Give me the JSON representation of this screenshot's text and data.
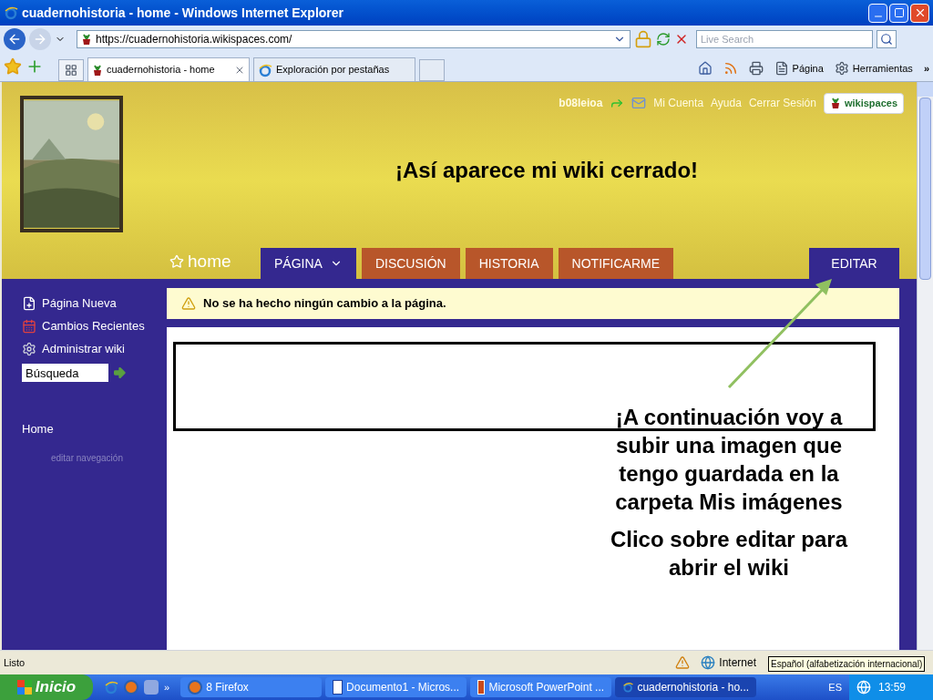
{
  "window": {
    "title": "cuadernohistoria - home - Windows Internet Explorer"
  },
  "address_bar": {
    "url": "https://cuadernohistoria.wikispaces.com/"
  },
  "search": {
    "placeholder": "Live Search"
  },
  "browser_tabs": [
    {
      "label": "cuadernohistoria - home",
      "selected": true
    },
    {
      "label": "Exploración por pestañas",
      "selected": false
    }
  ],
  "command_bar": {
    "page": "Página",
    "tools": "Herramientas",
    "more": "»"
  },
  "user_bar": {
    "username": "b08leioa",
    "links": [
      "Mi Cuenta",
      "Ayuda",
      "Cerrar Sesión"
    ],
    "logo": "wikispaces"
  },
  "header": {
    "title": "¡Así aparece mi wiki cerrado!"
  },
  "page_name": "home",
  "page_tabs": [
    {
      "label": "PÁGINA",
      "selected": true,
      "dropdown": true
    },
    {
      "label": "DISCUSIÓN",
      "selected": false,
      "dropdown": false
    },
    {
      "label": "HISTORIA",
      "selected": false,
      "dropdown": false
    },
    {
      "label": "NOTIFICARME",
      "selected": false,
      "dropdown": false
    }
  ],
  "edit_tab": "EDITAR",
  "sidebar": {
    "items": [
      {
        "label": "Página Nueva",
        "kind": "new"
      },
      {
        "label": "Cambios Recientes",
        "kind": "calendar"
      },
      {
        "label": "Administrar wiki",
        "kind": "gear"
      }
    ],
    "search_value": "Búsqueda",
    "nav": [
      "Home"
    ],
    "edit_nav": "editar navegación"
  },
  "notice": "No se ha hecho ningún cambio a la página.",
  "annotation": {
    "paragraphs": [
      "¡A continuación voy a subir una imagen que tengo guardada en la carpeta Mis imágenes",
      "Clico sobre editar para abrir el wiki"
    ]
  },
  "status_bar": {
    "text": "Listo",
    "zone": "Internet",
    "tooltip": "Español (alfabetización internacional)"
  },
  "taskbar": {
    "start": "Inicio",
    "more": "»",
    "buttons": [
      {
        "label": "8 Firefox",
        "kind": "firefox",
        "selected": false
      },
      {
        "label": "Documento1 - Micros...",
        "kind": "word",
        "selected": false
      },
      {
        "label": "Microsoft PowerPoint ...",
        "kind": "powerpoint",
        "selected": false
      },
      {
        "label": "cuadernohistoria - ho...",
        "kind": "ie",
        "selected": true
      }
    ],
    "language": "ES",
    "clock": "13:59"
  }
}
